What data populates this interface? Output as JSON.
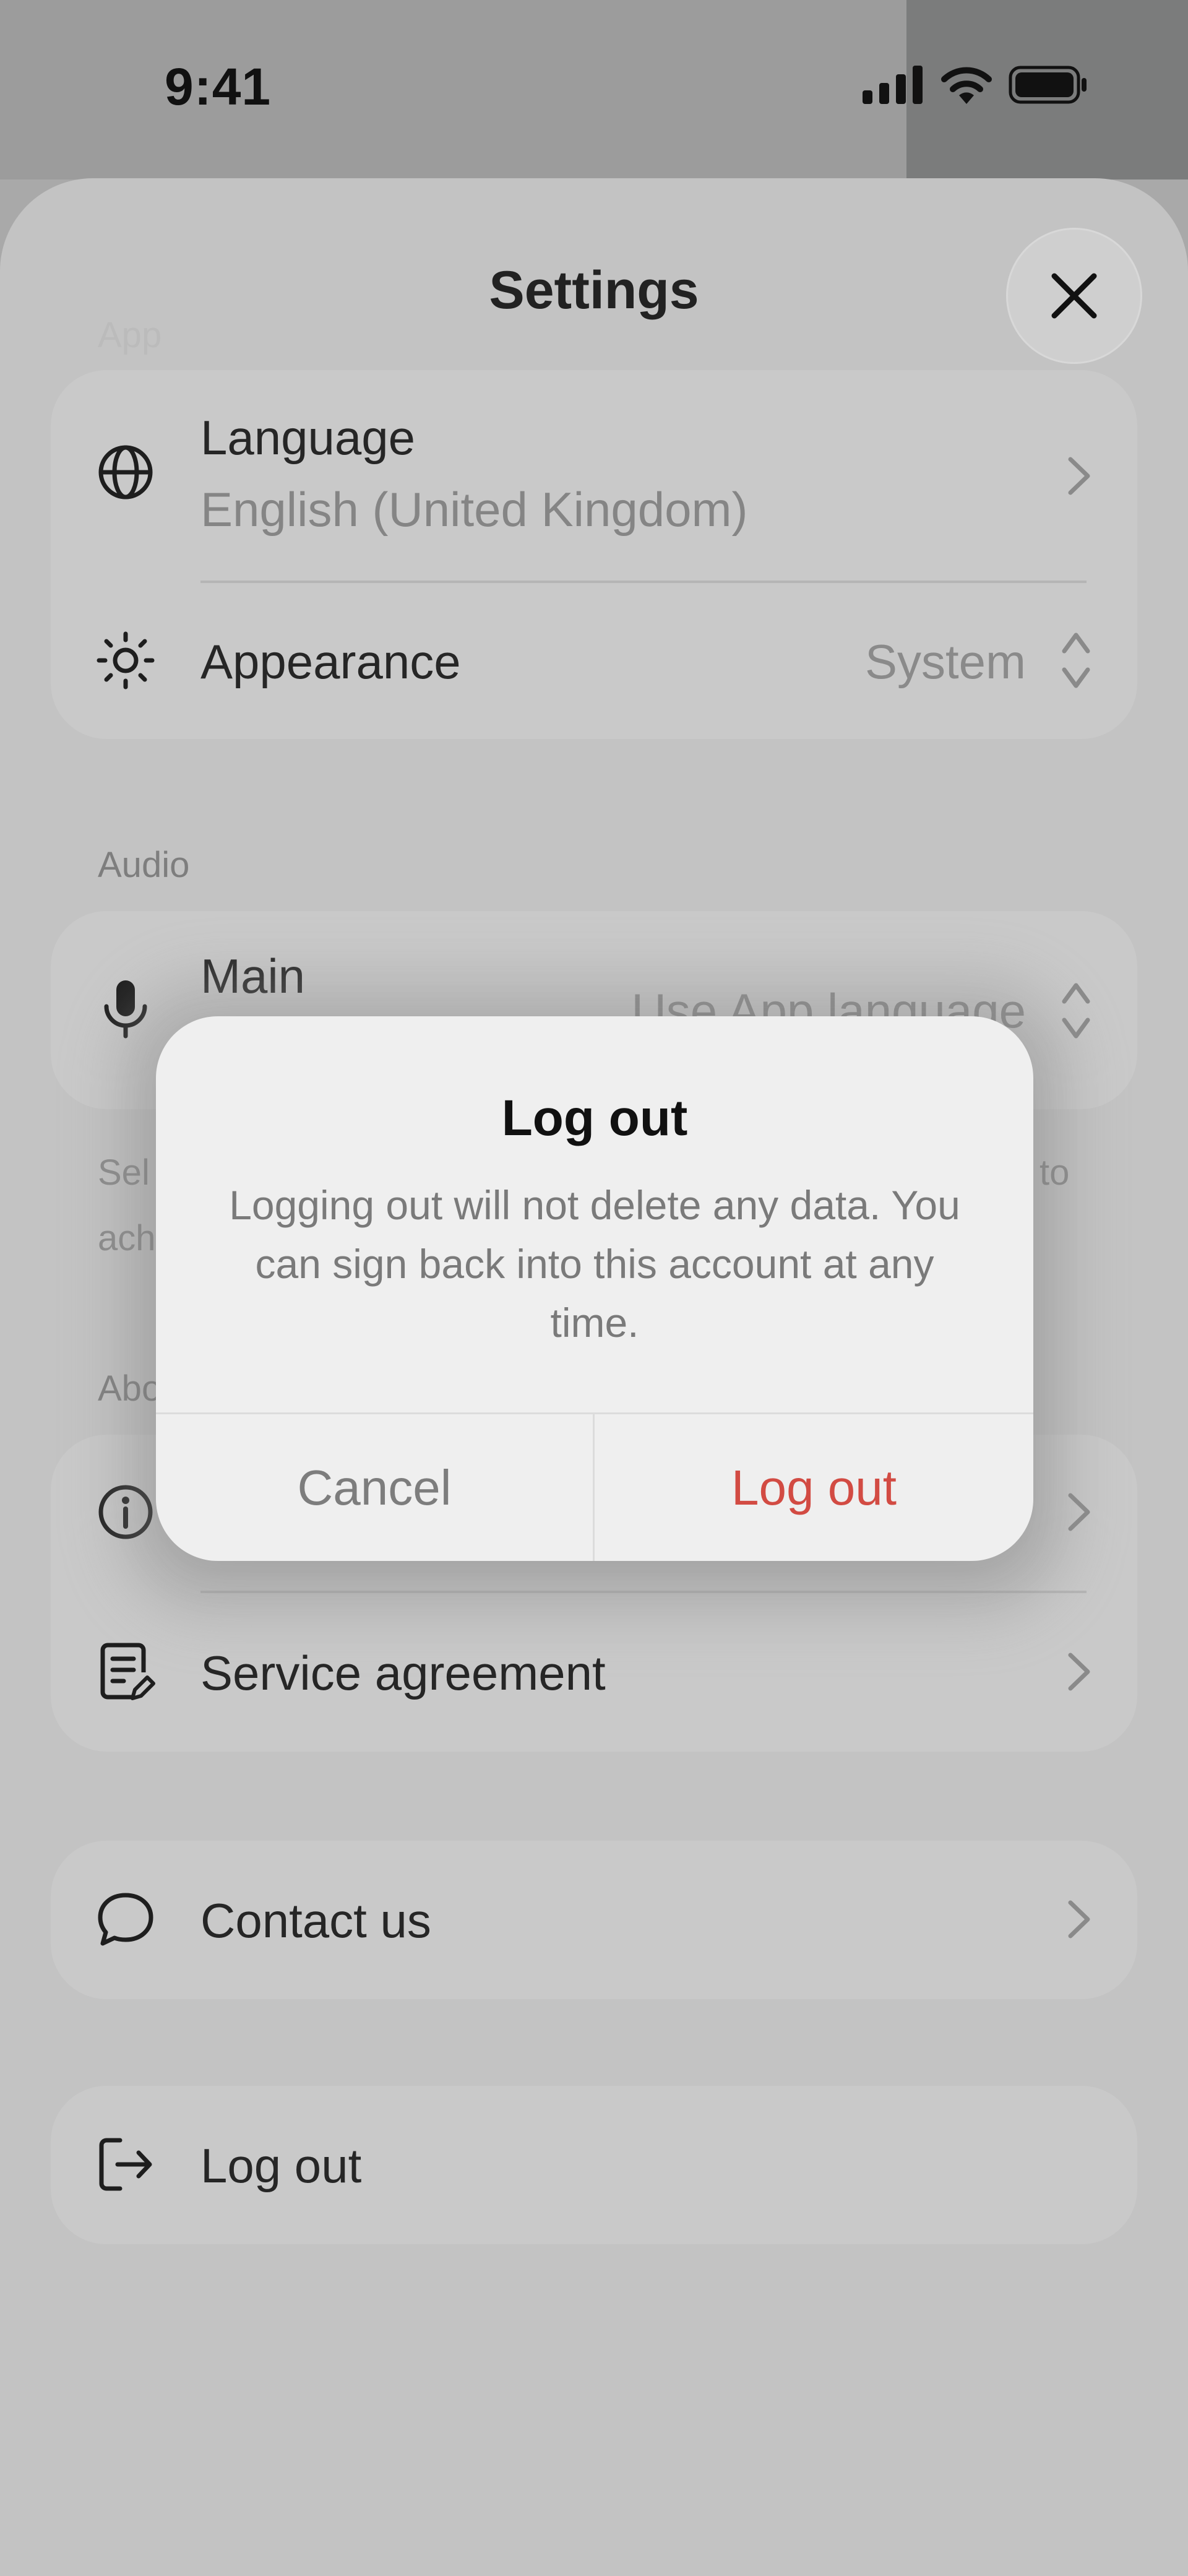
{
  "status_bar": {
    "time": "9:41"
  },
  "sheet": {
    "title": "Settings"
  },
  "sections": {
    "app": {
      "label": "App"
    },
    "audio": {
      "label": "Audio"
    },
    "about": {
      "label": "Abo"
    }
  },
  "app_card": {
    "language": {
      "label": "Language",
      "value": "English (United Kingdom)"
    },
    "appearance": {
      "label": "Appearance",
      "value": "System"
    }
  },
  "audio_card": {
    "main": {
      "label": "Main",
      "value": "Use App language"
    },
    "help_line1_start": "Sel",
    "help_line1_end": "to",
    "help_line2_start": "ach"
  },
  "about_card": {
    "service": {
      "label": "Service agreement"
    }
  },
  "contact": {
    "label": "Contact us"
  },
  "logout_row": {
    "label": "Log out"
  },
  "dialog": {
    "title": "Log out",
    "message": "Logging out will not delete any data. You can sign back into this account at any time.",
    "cancel": "Cancel",
    "confirm": "Log out"
  },
  "colors": {
    "destructive": "#d24b43"
  },
  "icons": [
    "globe-icon",
    "sun-icon",
    "microphone-icon",
    "info-icon",
    "document-edit-icon",
    "chat-bubble-icon",
    "logout-icon",
    "close-icon",
    "chevron-right-icon",
    "updown-chevron-icon"
  ]
}
